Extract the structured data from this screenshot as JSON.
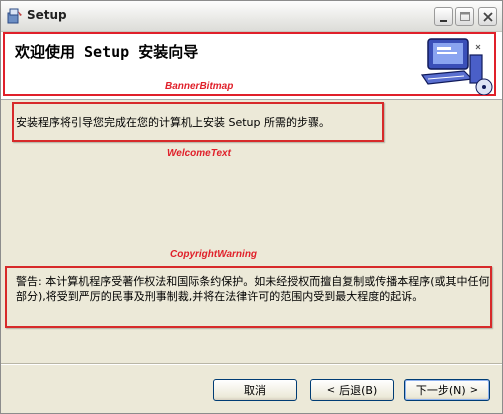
{
  "window": {
    "title": "Setup"
  },
  "banner": {
    "title": "欢迎使用 Setup 安装向导"
  },
  "annotations": {
    "banner": "BannerBitmap",
    "welcome": "WelcomeText",
    "copyright": "CopyrightWarning"
  },
  "welcome_text": "安装程序将引导您完成在您的计算机上安装 Setup 所需的步骤。",
  "copyright_text": "警告: 本计算机程序受著作权法和国际条约保护。如未经授权而擅自复制或传播本程序(或其中任何部分),将受到严厉的民事及刑事制裁,并将在法律许可的范围内受到最大程度的起诉。",
  "buttons": {
    "cancel": "取消",
    "back_arrow": "<",
    "back": "后退(B)",
    "next": "下一步(N)",
    "next_arrow": ">"
  },
  "colors": {
    "annotation": "#e0202a",
    "dialog": "#ece9d8"
  }
}
